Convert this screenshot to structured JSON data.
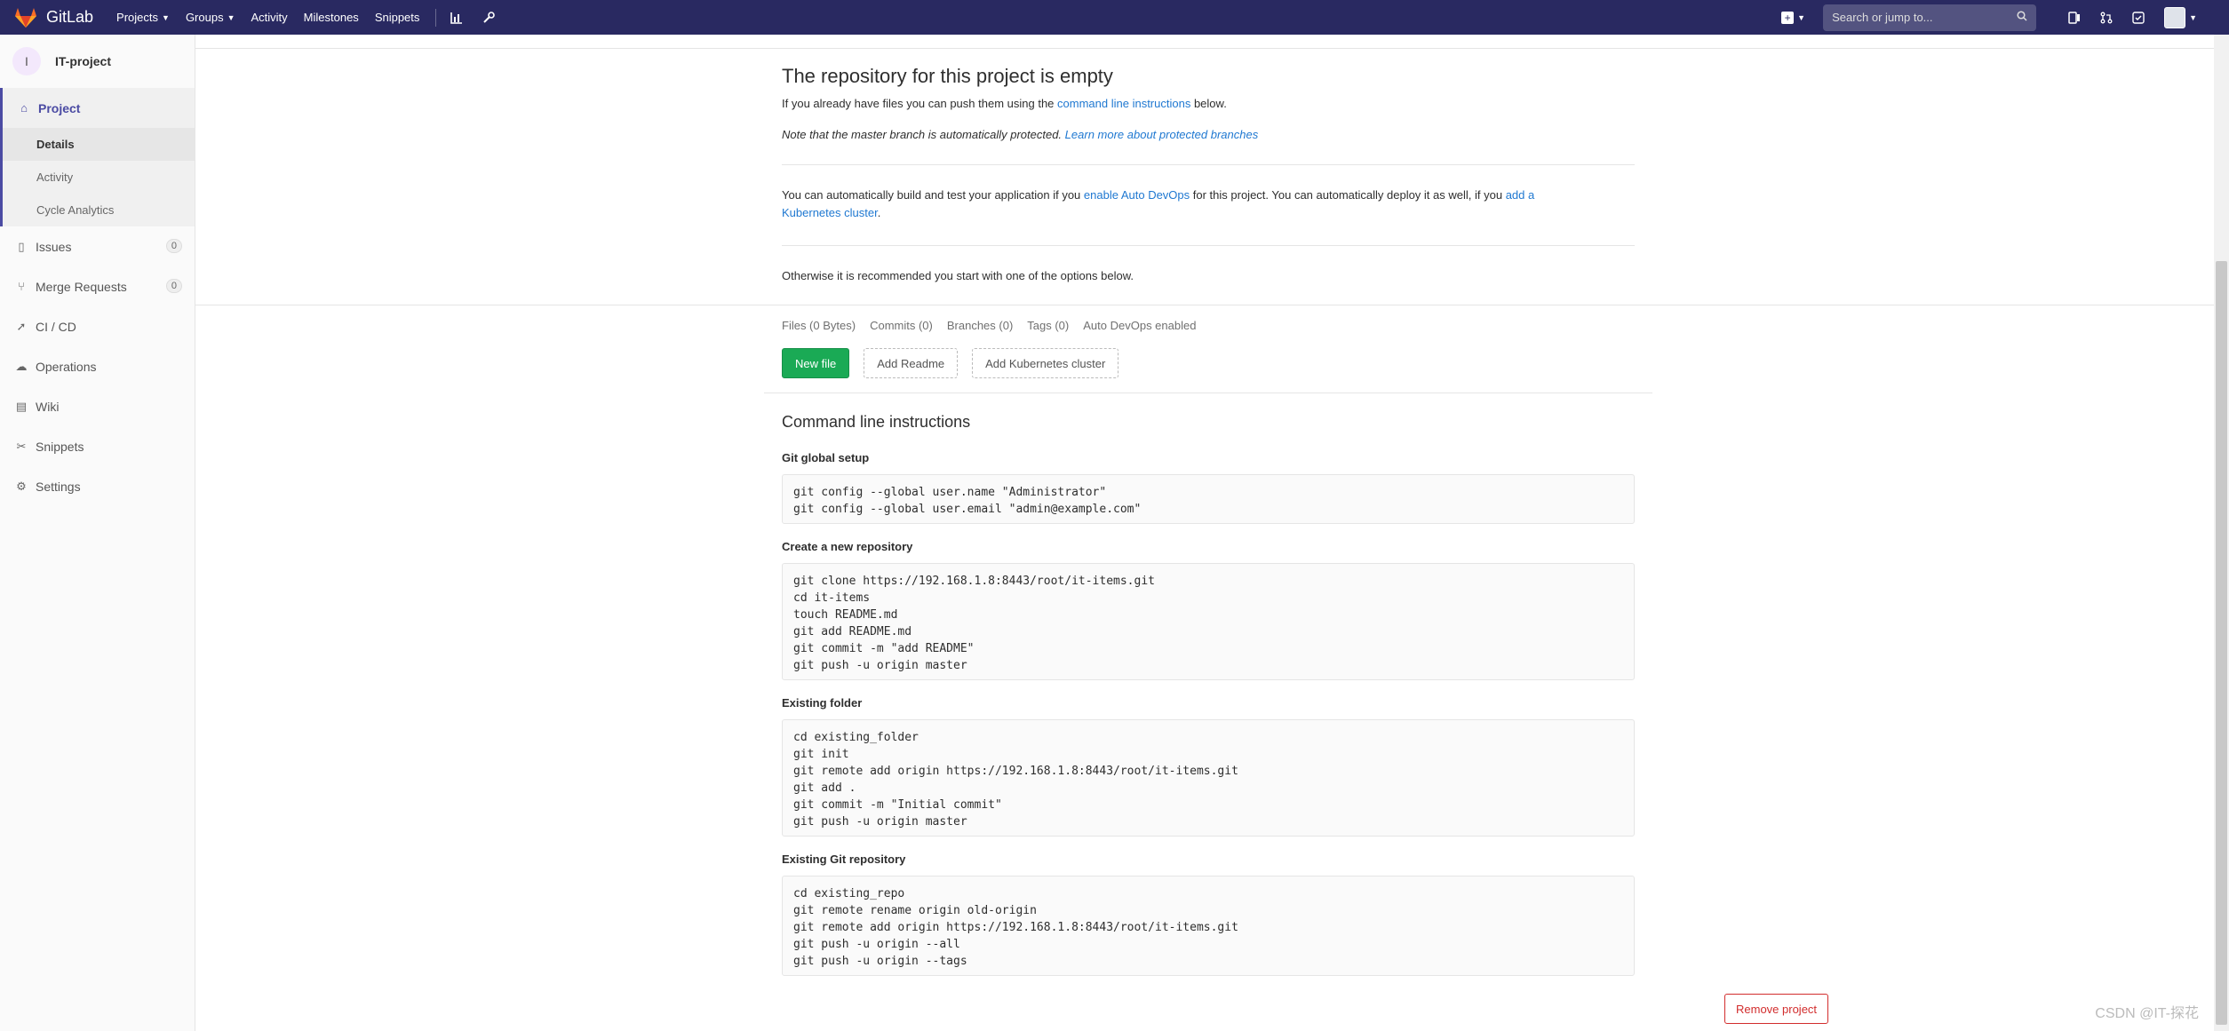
{
  "navbar": {
    "brand": "GitLab",
    "links": [
      {
        "label": "Projects",
        "dropdown": true
      },
      {
        "label": "Groups",
        "dropdown": true
      },
      {
        "label": "Activity",
        "dropdown": false
      },
      {
        "label": "Milestones",
        "dropdown": false
      },
      {
        "label": "Snippets",
        "dropdown": false
      }
    ],
    "search_placeholder": "Search or jump to...",
    "bg_color": "#292961"
  },
  "sidebar": {
    "project_avatar_letter": "I",
    "project_name": "IT-project",
    "project_label": "Project",
    "sub_items": [
      "Details",
      "Activity",
      "Cycle Analytics"
    ],
    "items": [
      {
        "label": "Issues",
        "count": "0",
        "icon": "issues-icon"
      },
      {
        "label": "Merge Requests",
        "count": "0",
        "icon": "merge-request-icon"
      },
      {
        "label": "CI / CD",
        "icon": "rocket-icon"
      },
      {
        "label": "Operations",
        "icon": "operations-icon"
      },
      {
        "label": "Wiki",
        "icon": "book-icon"
      },
      {
        "label": "Snippets",
        "icon": "scissors-icon"
      },
      {
        "label": "Settings",
        "icon": "gear-icon"
      }
    ]
  },
  "empty": {
    "title": "The repository for this project is empty",
    "push_prefix": "If you already have files you can push them using the ",
    "push_link": "command line instructions",
    "push_suffix": " below.",
    "note_text": "Note that the master branch is automatically protected. ",
    "note_link": "Learn more about protected branches",
    "devops_prefix": "You can automatically build and test your application if you ",
    "devops_link": "enable Auto DevOps",
    "devops_middle": " for this project. You can automatically deploy it as well, if you ",
    "devops_link2": "add a",
    "devops_link3": "Kubernetes cluster",
    "devops_end": ".",
    "otherwise": "Otherwise it is recommended you start with one of the options below."
  },
  "stats": [
    "Files (0 Bytes)",
    "Commits (0)",
    "Branches (0)",
    "Tags (0)",
    "Auto DevOps enabled"
  ],
  "buttons": {
    "new_file": "New file",
    "add_readme": "Add Readme",
    "add_kubernetes": "Add Kubernetes cluster",
    "remove_project": "Remove project"
  },
  "cli": {
    "title": "Command line instructions",
    "sections": [
      {
        "title": "Git global setup",
        "code": "git config --global user.name \"Administrator\"\ngit config --global user.email \"admin@example.com\""
      },
      {
        "title": "Create a new repository",
        "code": "git clone https://192.168.1.8:8443/root/it-items.git\ncd it-items\ntouch README.md\ngit add README.md\ngit commit -m \"add README\"\ngit push -u origin master"
      },
      {
        "title": "Existing folder",
        "code": "cd existing_folder\ngit init\ngit remote add origin https://192.168.1.8:8443/root/it-items.git\ngit add .\ngit commit -m \"Initial commit\"\ngit push -u origin master"
      },
      {
        "title": "Existing Git repository",
        "code": "cd existing_repo\ngit remote rename origin old-origin\ngit remote add origin https://192.168.1.8:8443/root/it-items.git\ngit push -u origin --all\ngit push -u origin --tags"
      }
    ]
  },
  "watermark": "CSDN @IT-探花"
}
